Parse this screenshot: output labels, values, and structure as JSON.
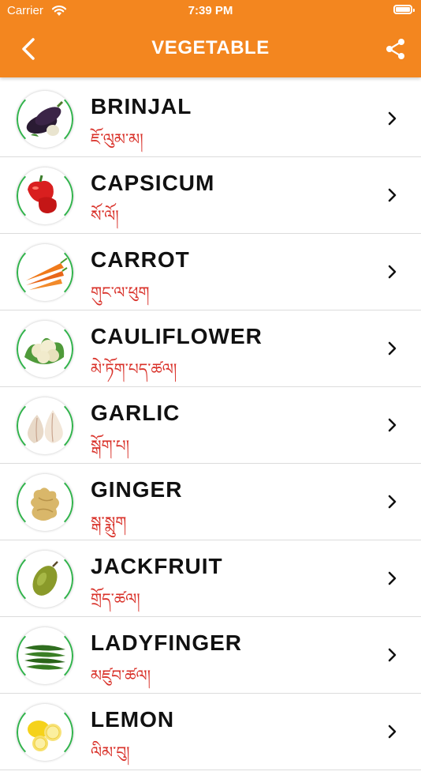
{
  "status_bar": {
    "carrier": "Carrier",
    "time": "7:39 PM"
  },
  "header": {
    "title": "VEGETABLE",
    "back_icon": "chevron-left-icon",
    "share_icon": "share-icon",
    "color": "#f3861f"
  },
  "items": [
    {
      "name": "BRINJAL",
      "local": "ཇོ་ལུམ་མ།",
      "image": "brinjal"
    },
    {
      "name": "CAPSICUM",
      "local": "སོ་ལོ།",
      "image": "capsicum"
    },
    {
      "name": "CARROT",
      "local": "གུང་ལ་ཕུག",
      "image": "carrot"
    },
    {
      "name": "CAULIFLOWER",
      "local": "མེ་ཏོག་པད་ཚལ།",
      "image": "cauliflower"
    },
    {
      "name": "GARLIC",
      "local": "སྒོག་པ།",
      "image": "garlic"
    },
    {
      "name": "GINGER",
      "local": "སྒ་སྨུག",
      "image": "ginger"
    },
    {
      "name": "JACKFRUIT",
      "local": "གྲོད་ཚལ།",
      "image": "jackfruit"
    },
    {
      "name": "LADYFINGER",
      "local": "མཛུབ་ཚལ།",
      "image": "ladyfinger"
    },
    {
      "name": "LEMON",
      "local": "ལིམ་བུ།",
      "image": "lemon"
    }
  ]
}
